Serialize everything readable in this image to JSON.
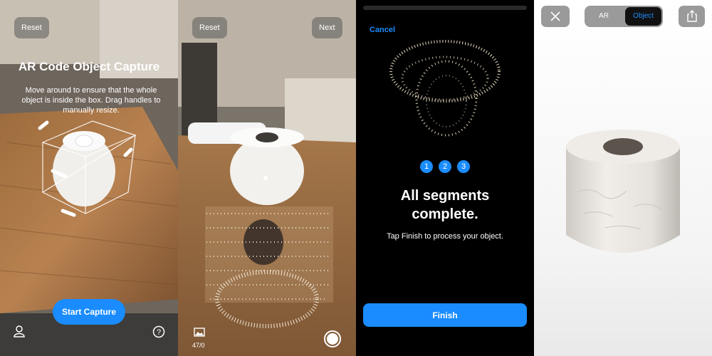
{
  "panel1": {
    "reset_label": "Reset",
    "title": "AR Code Object Capture",
    "instructions": "Move around to ensure that the whole object is inside the box. Drag handles to manually resize.",
    "start_label": "Start Capture",
    "icons": [
      "person-icon",
      "help-icon"
    ]
  },
  "panel2": {
    "reset_label": "Reset",
    "next_label": "Next",
    "photo_count": "47/0",
    "icons": [
      "gallery-icon",
      "shutter-icon"
    ]
  },
  "panel3": {
    "cancel_label": "Cancel",
    "segments": [
      "1",
      "2",
      "3"
    ],
    "heading": "All segments complete.",
    "subtext": "Tap Finish to process your object.",
    "finish_label": "Finish"
  },
  "panel4": {
    "segment_ar": "AR",
    "segment_object": "Object",
    "icons": [
      "close-icon",
      "share-icon"
    ]
  },
  "colors": {
    "accent": "#1a8cff",
    "dark_panel": "#000000"
  }
}
